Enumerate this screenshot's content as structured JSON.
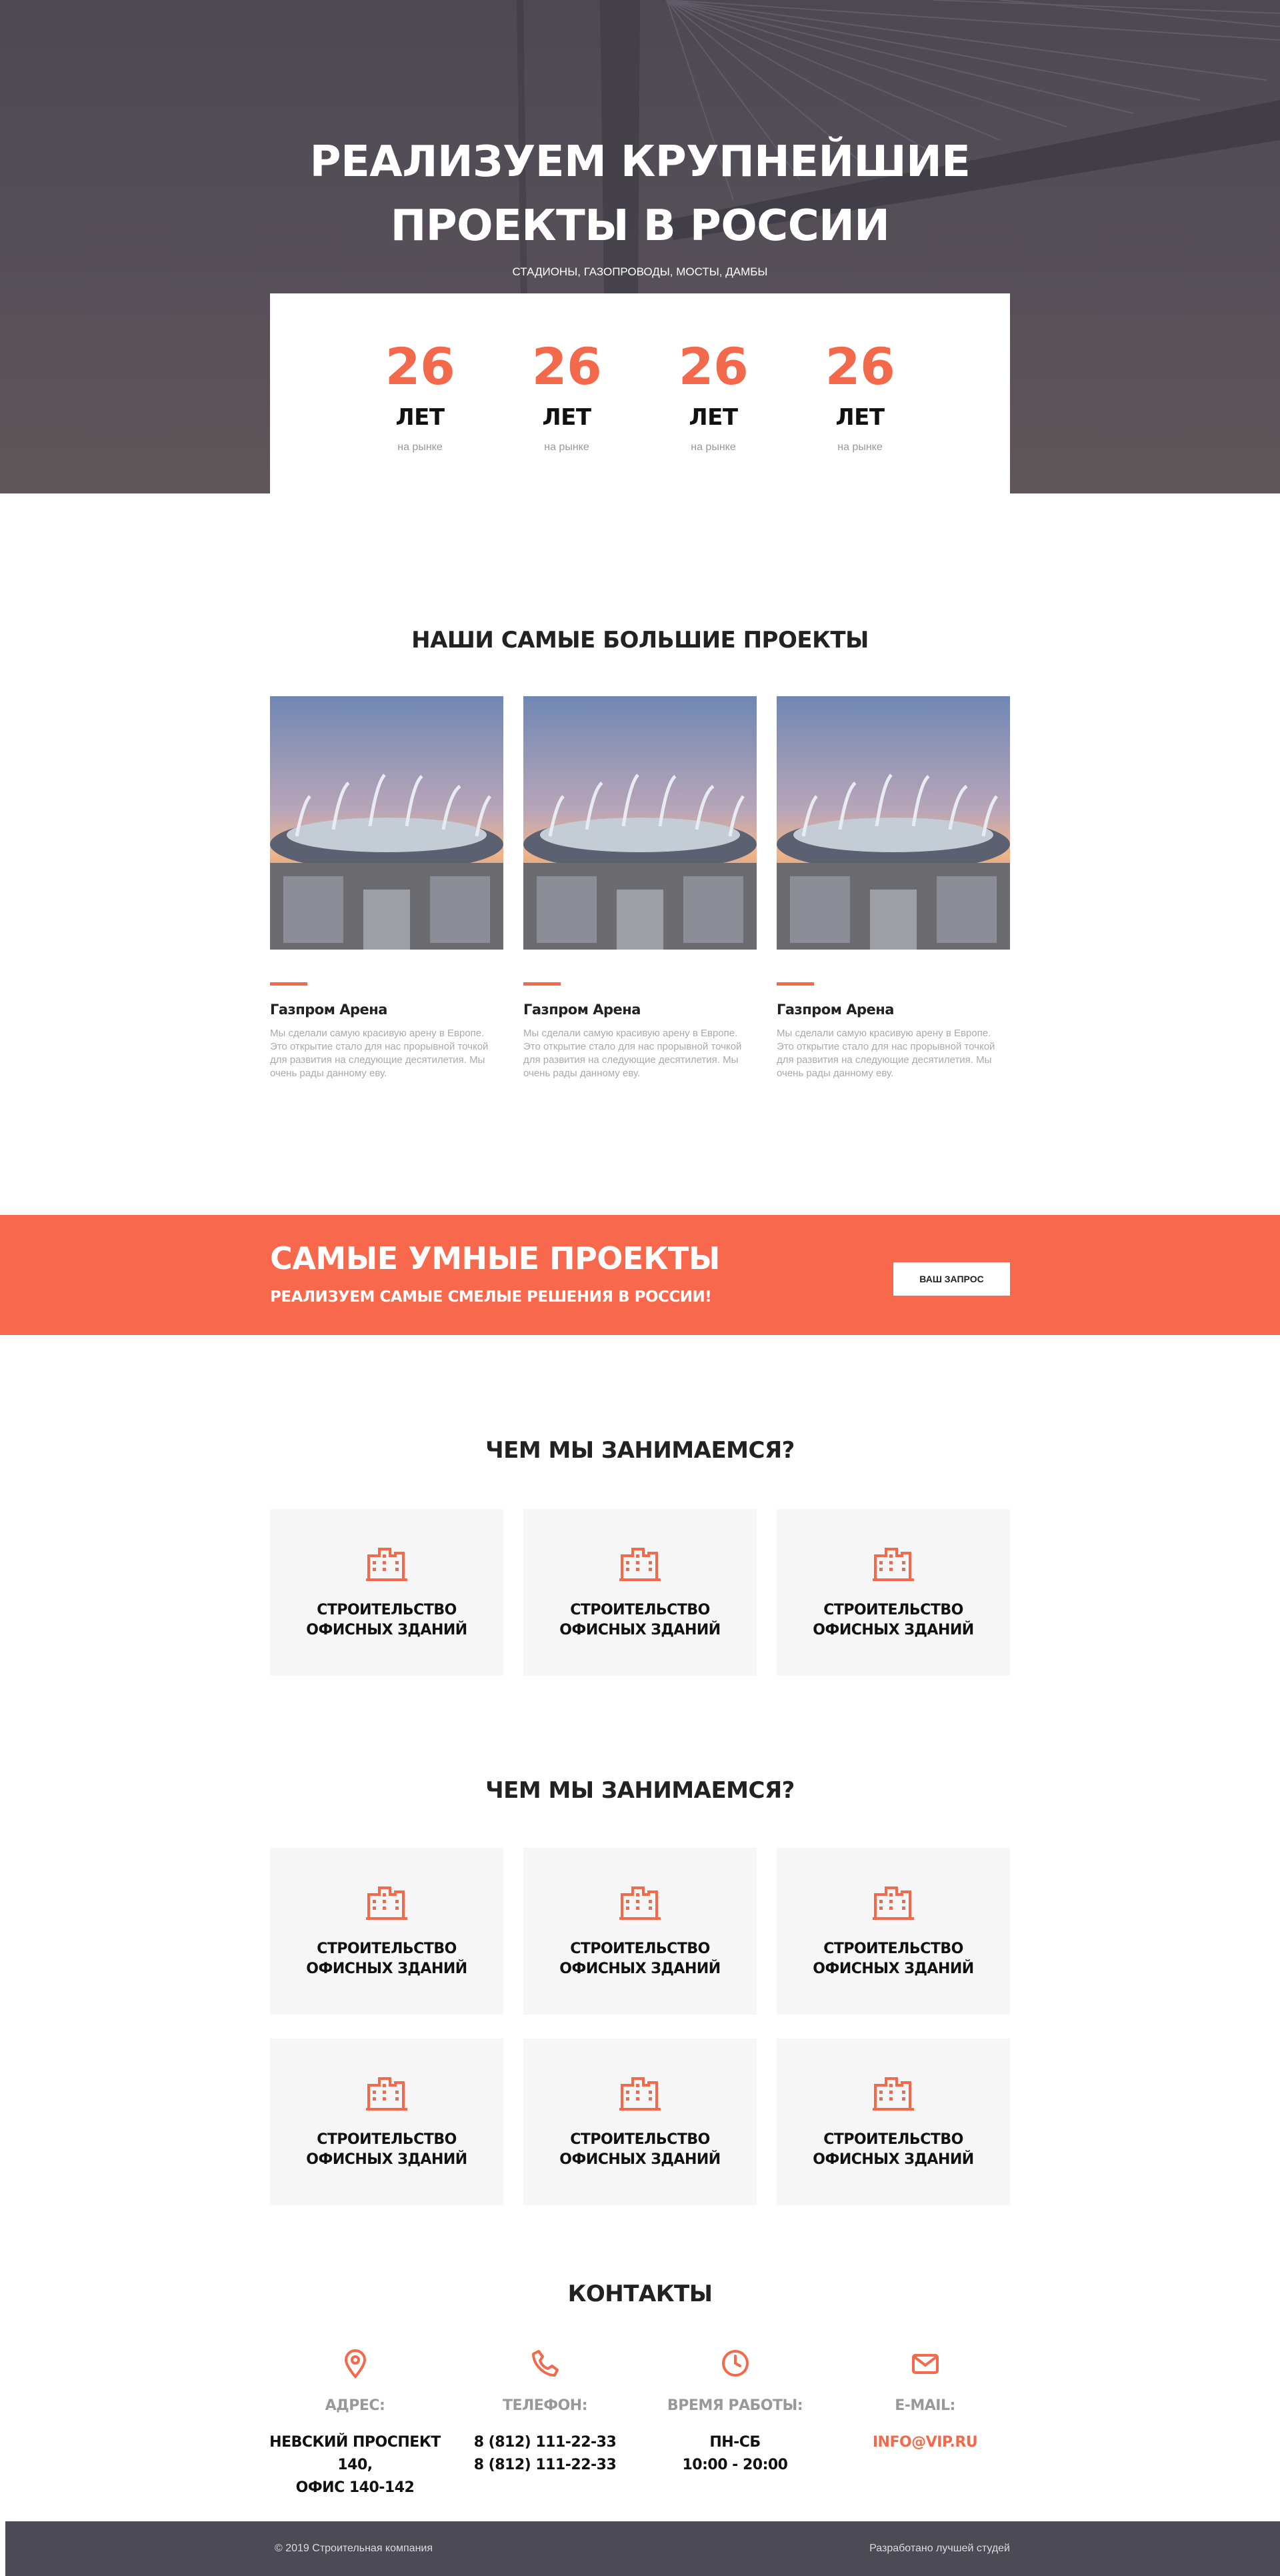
{
  "hero": {
    "title_line1": "РЕАЛИЗУЕМ КРУПНЕЙШИЕ",
    "title_line2": "ПРОЕКТЫ В РОССИИ",
    "subtitle": "СТАДИОНЫ, ГАЗОПРОВОДЫ, МОСТЫ, ДАМБЫ",
    "stats": [
      {
        "number": "26",
        "unit": "ЛЕТ",
        "caption": "на рынке"
      },
      {
        "number": "26",
        "unit": "ЛЕТ",
        "caption": "на рынке"
      },
      {
        "number": "26",
        "unit": "ЛЕТ",
        "caption": "на рынке"
      },
      {
        "number": "26",
        "unit": "ЛЕТ",
        "caption": "на рынке"
      }
    ]
  },
  "projects": {
    "title": "НАШИ САМЫЕ БОЛЬШИЕ ПРОЕКТЫ",
    "items": [
      {
        "name": "Газпром Арена",
        "description": "Мы сделали самую красивую арену в Европе. Это открытие стало для нас прорывной точкой для развития на следующие десятилетия. Мы очень рады данному еву."
      },
      {
        "name": "Газпром Арена",
        "description": "Мы сделали самую красивую арену в Европе. Это открытие стало для нас прорывной точкой для развития на следующие десятилетия. Мы очень рады данному еву."
      },
      {
        "name": "Газпром Арена",
        "description": "Мы сделали самую красивую арену в Европе. Это открытие стало для нас прорывной точкой для развития на следующие десятилетия. Мы очень рады данному еву."
      }
    ]
  },
  "cta": {
    "title": "САМЫЕ УМНЫЕ ПРОЕКТЫ",
    "subtitle": "РЕАЛИЗУЕМ САМЫЕ СМЕЛЫЕ РЕШЕНИЯ В РОССИИ!",
    "button": "ВАШ ЗАПРОС"
  },
  "services1": {
    "title": "ЧЕМ МЫ ЗАНИМАЕМСЯ?",
    "items": [
      {
        "line1": "СТРОИТЕЛЬСТВО",
        "line2": "ОФИСНЫХ ЗДАНИЙ",
        "icon": "building-icon"
      },
      {
        "line1": "СТРОИТЕЛЬСТВО",
        "line2": "ОФИСНЫХ ЗДАНИЙ",
        "icon": "building-icon"
      },
      {
        "line1": "СТРОИТЕЛЬСТВО",
        "line2": "ОФИСНЫХ ЗДАНИЙ",
        "icon": "building-icon"
      }
    ]
  },
  "services2": {
    "title": "ЧЕМ МЫ ЗАНИМАЕМСЯ?",
    "items": [
      {
        "line1": "СТРОИТЕЛЬСТВО",
        "line2": "ОФИСНЫХ ЗДАНИЙ",
        "icon": "building-icon"
      },
      {
        "line1": "СТРОИТЕЛЬСТВО",
        "line2": "ОФИСНЫХ ЗДАНИЙ",
        "icon": "building-icon"
      },
      {
        "line1": "СТРОИТЕЛЬСТВО",
        "line2": "ОФИСНЫХ ЗДАНИЙ",
        "icon": "building-icon"
      },
      {
        "line1": "СТРОИТЕЛЬСТВО",
        "line2": "ОФИСНЫХ ЗДАНИЙ",
        "icon": "building-icon"
      },
      {
        "line1": "СТРОИТЕЛЬСТВО",
        "line2": "ОФИСНЫХ ЗДАНИЙ",
        "icon": "building-icon"
      },
      {
        "line1": "СТРОИТЕЛЬСТВО",
        "line2": "ОФИСНЫХ ЗДАНИЙ",
        "icon": "building-icon"
      }
    ]
  },
  "contacts": {
    "title": "КОНТАКТЫ",
    "address": {
      "label": "АДРЕС:",
      "line1": "НЕВСКИЙ ПРОСПЕКТ 140,",
      "line2": "ОФИС 140-142",
      "icon": "map-pin-icon"
    },
    "phone": {
      "label": "ТЕЛЕФОН:",
      "line1": "8 (812) 111-22-33",
      "line2": "8 (812) 111-22-33",
      "icon": "phone-icon"
    },
    "hours": {
      "label": "ВРЕМЯ РАБОТЫ:",
      "line1": "ПН-СБ",
      "line2": "10:00 - 20:00",
      "icon": "clock-icon"
    },
    "email": {
      "label": "E-MAIL:",
      "value": "INFO@VIP.RU",
      "icon": "mail-icon"
    }
  },
  "footer": {
    "copyright": "© 2019 Строительная компания",
    "credit": "Разработано лучшей студей"
  },
  "colors": {
    "accent": "#f26a4b",
    "hero_bg": "#544e57",
    "footer_bg": "#4b4a55",
    "card_bg": "#f6f6f6"
  }
}
